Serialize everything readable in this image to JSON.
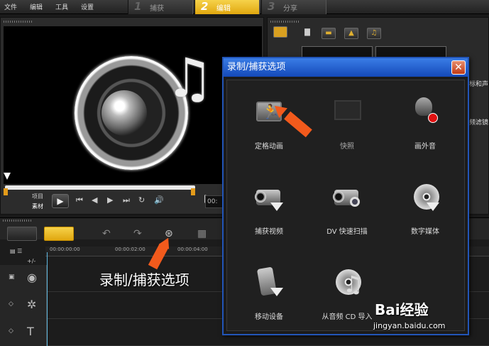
{
  "menu": {
    "items": [
      "文件",
      "编辑",
      "工具",
      "设置"
    ]
  },
  "steps": [
    {
      "num": "1",
      "label": "捕获"
    },
    {
      "num": "2",
      "label": "编辑"
    },
    {
      "num": "3",
      "label": "分享"
    }
  ],
  "preview": {
    "project_label": "项目",
    "clip_label": "素材",
    "play_symbol": "▶",
    "time": "00:"
  },
  "library": {
    "side_text_1": "标和声",
    "side_text_2": "频滤镜"
  },
  "timeline": {
    "ruler_ticks": [
      "00:00:00:00",
      "00:00:02:00",
      "00:00:04:00"
    ],
    "zoom_label": "+/-"
  },
  "annotation": {
    "text": "录制/捕获选项"
  },
  "dialog": {
    "title": "录制/捕获选项",
    "close_symbol": "✕",
    "options": [
      {
        "label": "定格动画",
        "icon": "stop-motion-icon",
        "enabled": true
      },
      {
        "label": "快照",
        "icon": "snapshot-icon",
        "enabled": false
      },
      {
        "label": "画外音",
        "icon": "voiceover-icon",
        "enabled": true
      },
      {
        "label": "捕获视频",
        "icon": "capture-video-icon",
        "enabled": true
      },
      {
        "label": "DV 快速扫描",
        "icon": "dv-quick-scan-icon",
        "enabled": true
      },
      {
        "label": "数字媒体",
        "icon": "digital-media-icon",
        "enabled": true
      },
      {
        "label": "移动设备",
        "icon": "mobile-device-icon",
        "enabled": true
      },
      {
        "label": "从音频 CD 导入",
        "icon": "audio-cd-import-icon",
        "enabled": true
      }
    ]
  },
  "watermark": {
    "brand": "Bai经验",
    "url": "jingyan.baidu.com"
  },
  "colors": {
    "accent": "#f0b51c",
    "dialog_title": "#1c55c8",
    "arrow": "#f25a1c"
  }
}
